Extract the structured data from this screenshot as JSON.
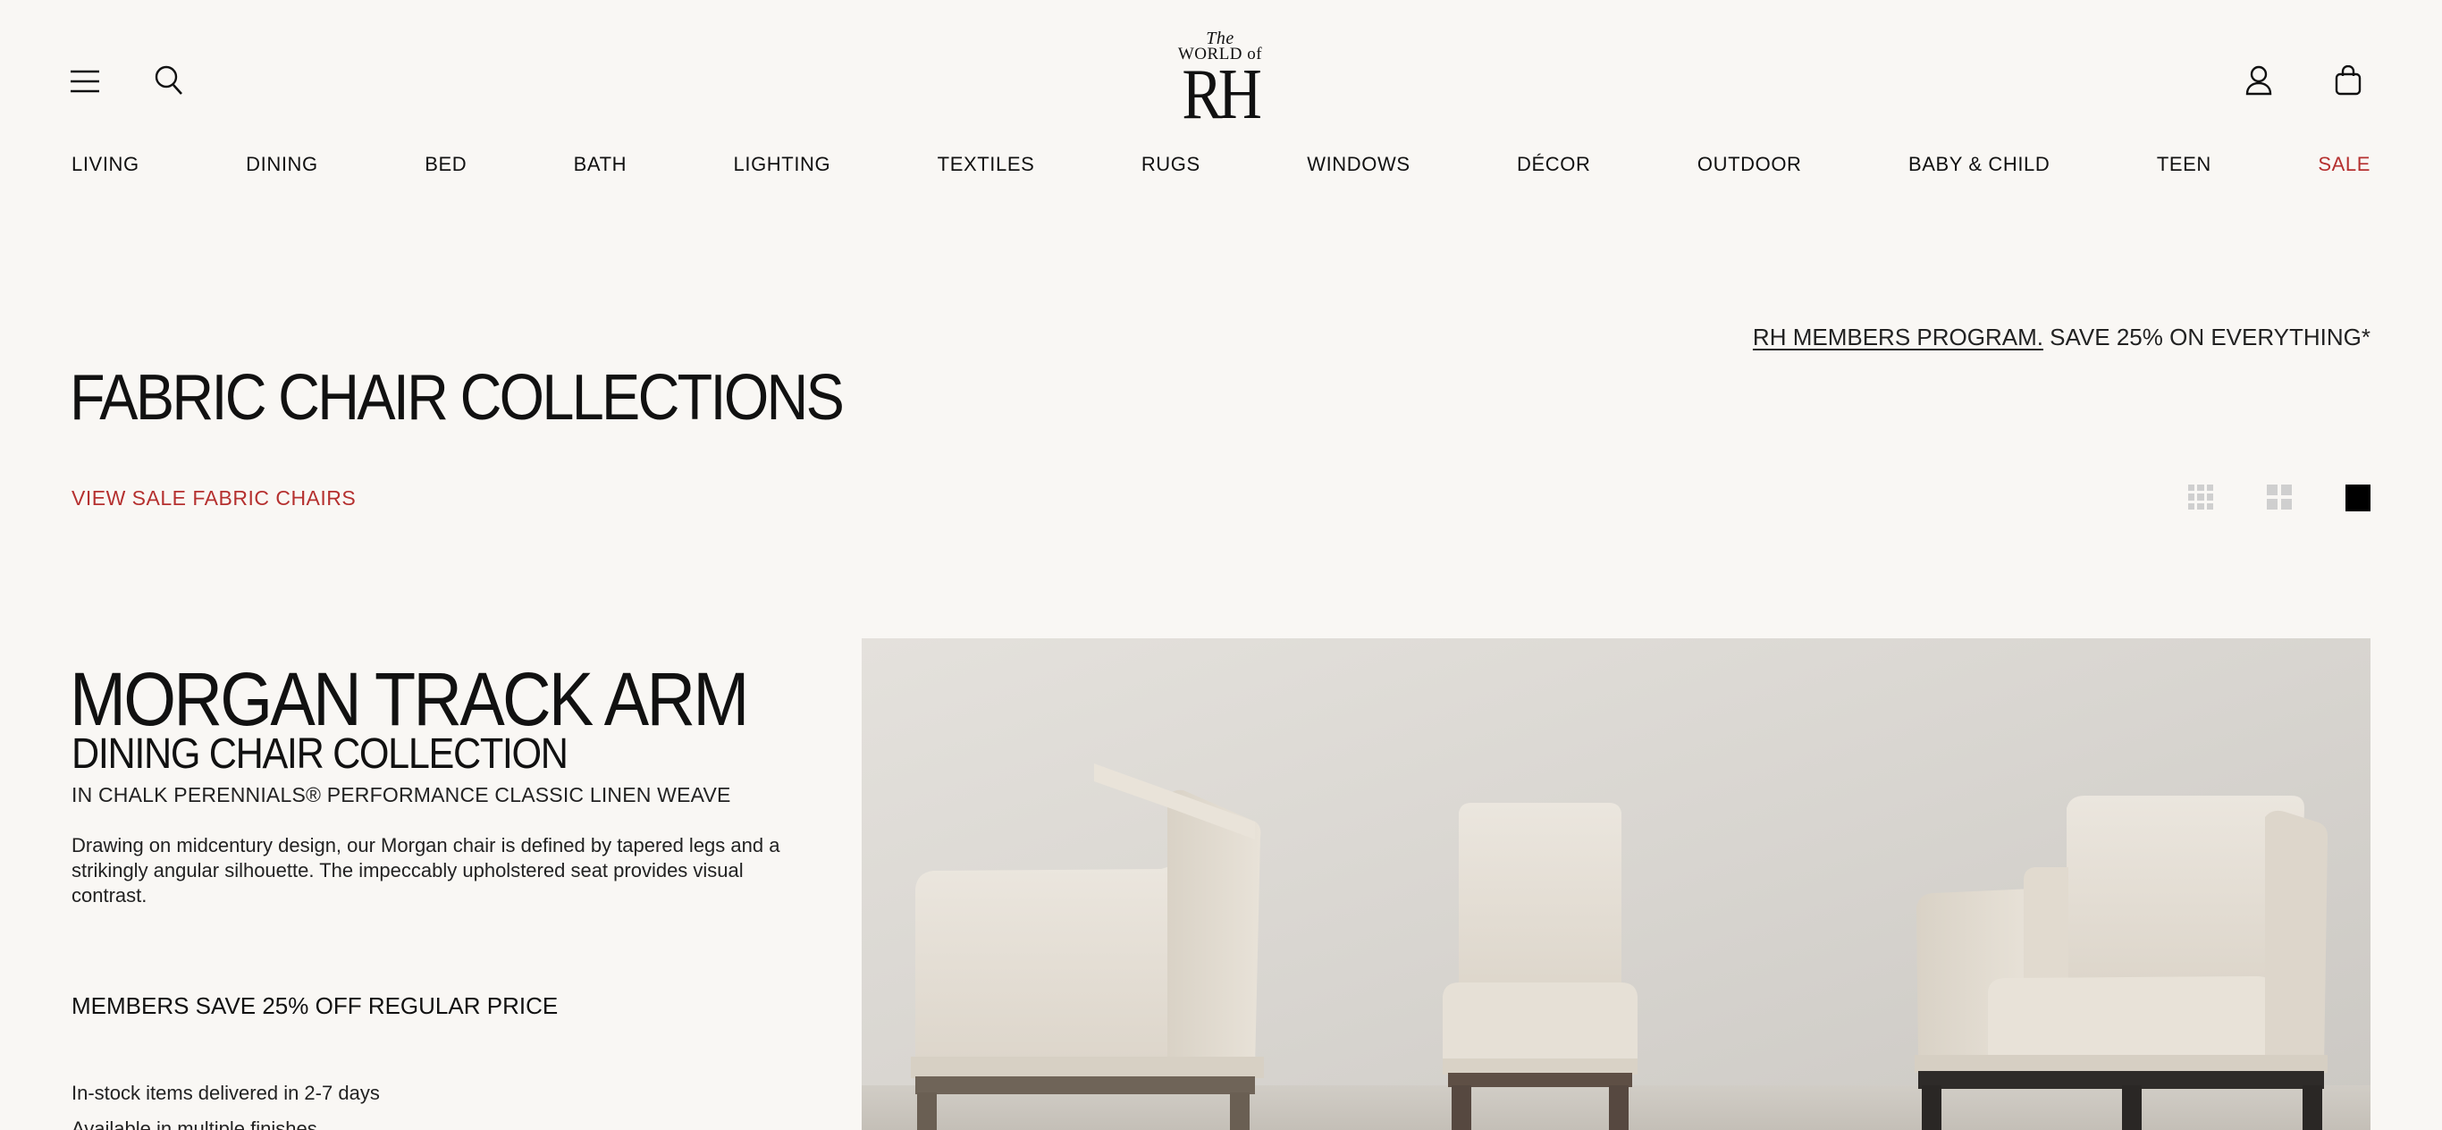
{
  "header": {
    "logo": {
      "line1": "The",
      "line2": "WORLD of",
      "mark": "RH"
    },
    "icons": {
      "menu": "hamburger-icon",
      "search": "search-icon",
      "account": "account-icon",
      "bag": "shopping-bag-icon"
    }
  },
  "nav": [
    {
      "label": "LIVING"
    },
    {
      "label": "DINING"
    },
    {
      "label": "BED"
    },
    {
      "label": "BATH"
    },
    {
      "label": "LIGHTING"
    },
    {
      "label": "TEXTILES"
    },
    {
      "label": "RUGS"
    },
    {
      "label": "WINDOWS"
    },
    {
      "label": "DÉCOR"
    },
    {
      "label": "OUTDOOR"
    },
    {
      "label": "BABY & CHILD"
    },
    {
      "label": "TEEN"
    },
    {
      "label": "SALE",
      "accent": "#b5302f"
    }
  ],
  "promo": {
    "link": "RH MEMBERS PROGRAM.",
    "text": " SAVE 25% ON EVERYTHING*"
  },
  "page": {
    "title": "FABRIC CHAIR COLLECTIONS",
    "sale_link": "VIEW SALE FABRIC CHAIRS"
  },
  "view_toggles": {
    "options": [
      "grid-3-icon",
      "grid-2-icon",
      "grid-1-icon"
    ],
    "selected": "grid-1-icon"
  },
  "collection": {
    "title": "MORGAN TRACK ARM",
    "subtitle": "DINING CHAIR COLLECTION",
    "fabric": "IN CHALK PERENNIALS® PERFORMANCE CLASSIC LINEN WEAVE",
    "description": "Drawing on midcentury design, our Morgan chair is defined by tapered legs and a strikingly angular silhouette. The impeccably upholstered seat provides visual contrast.",
    "members": "MEMBERS SAVE 25% OFF REGULAR PRICE",
    "instock": "In-stock items delivered in 2-7 days",
    "availability": "Available in multiple finishes"
  },
  "colors": {
    "background": "#f9f7f4",
    "accent": "#b5302f",
    "text": "#111111"
  }
}
